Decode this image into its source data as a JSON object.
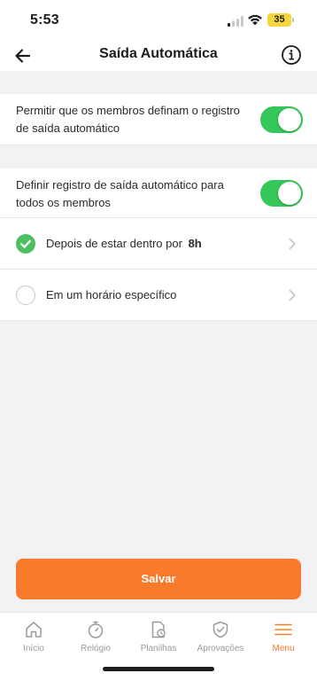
{
  "status_bar": {
    "time": "5:53",
    "battery": "35",
    "battery_color": "#f5d63c"
  },
  "header": {
    "title": "Saída Automática",
    "back_icon": "arrow-left-icon",
    "info_icon": "info-circle-icon"
  },
  "settings": {
    "allow_members": {
      "label": "Permitir que os membros definam o registro de saída automático",
      "enabled": true
    },
    "define_for_all": {
      "label": "Definir registro de saída automático para todos os membros",
      "enabled": true
    },
    "options": [
      {
        "label": "Depois de estar dentro por",
        "value": "8h",
        "selected": true
      },
      {
        "label": "Em um horário específico",
        "value": "",
        "selected": false
      }
    ]
  },
  "actions": {
    "save_label": "Salvar",
    "accent_color": "#f87b2b"
  },
  "tab_bar": {
    "items": [
      {
        "label": "Início",
        "icon": "home-icon",
        "active": false
      },
      {
        "label": "Relógio",
        "icon": "stopwatch-icon",
        "active": false
      },
      {
        "label": "Planilhas",
        "icon": "timesheet-icon",
        "active": false
      },
      {
        "label": "Aprovações",
        "icon": "shield-check-icon",
        "active": false
      },
      {
        "label": "Menu",
        "icon": "menu-icon",
        "active": true
      }
    ]
  },
  "colors": {
    "toggle_on": "#34c759",
    "check": "#4cc061",
    "background": "#f2f2f4"
  }
}
